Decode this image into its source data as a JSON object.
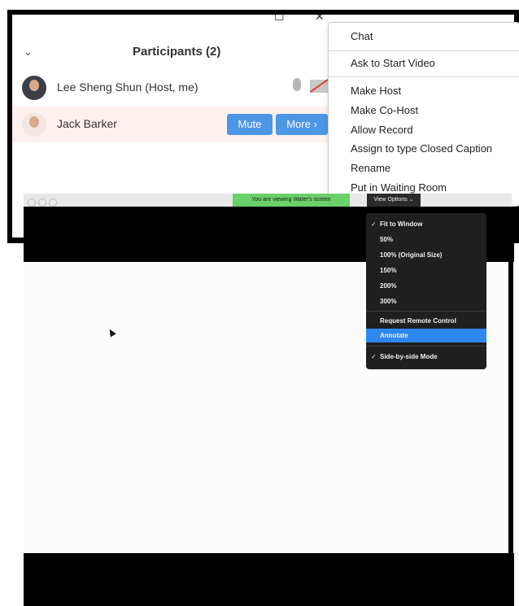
{
  "window": {
    "maximize_glyph": "☐",
    "close_glyph": "✕"
  },
  "participants": {
    "collapse_icon": "⌄",
    "title": "Participants (2)",
    "rows": [
      {
        "name": "Lee Sheng Shun (Host, me)"
      },
      {
        "name": "Jack Barker",
        "mute_label": "Mute",
        "more_label": "More ›"
      }
    ]
  },
  "context_menu": {
    "items": [
      "Chat",
      "Ask to Start Video",
      "Make Host",
      "Make Co-Host",
      "Allow Record",
      "Assign to type Closed Caption",
      "Rename",
      "Put in Waiting Room"
    ]
  },
  "share_bar": {
    "viewing_text": "You are viewing Water's screen",
    "view_options_label": "View Options ⌄"
  },
  "view_menu": {
    "check_glyph": "✓",
    "items": [
      "Fit to Window",
      "50%",
      "100% (Original Size)",
      "150%",
      "200%",
      "300%",
      "Request Remote Control",
      "Annotate",
      "Side-by-side Mode"
    ],
    "checked": [
      "Fit to Window",
      "Side-by-side Mode"
    ],
    "highlighted": "Annotate"
  },
  "colors": {
    "accent": "#4d96e6",
    "viewing_green": "#6ad06a",
    "highlight": "#2e88f0"
  }
}
